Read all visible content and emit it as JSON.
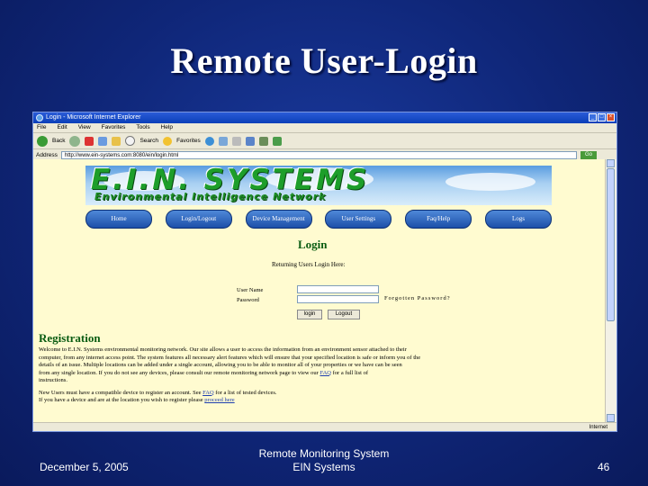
{
  "slide": {
    "title": "Remote User-Login",
    "footer_date": "December 5, 2005",
    "footer_center_line1": "Remote Monitoring System",
    "footer_center_line2": "EIN Systems",
    "slide_number": "46"
  },
  "browser": {
    "window_title": "Login - Microsoft Internet Explorer",
    "menu": [
      "File",
      "Edit",
      "View",
      "Favorites",
      "Tools",
      "Help"
    ],
    "toolbar": {
      "back": "Back",
      "search": "Search",
      "favorites": "Favorites"
    },
    "address_label": "Address",
    "address_value": "http://www.ein-systems.com:8080/ein/login.html",
    "go_label": "Go",
    "status_zone": "Internet"
  },
  "site": {
    "banner_title": "E.I.N. SYSTEMS",
    "banner_subtitle": "Environmental Intelligence Network",
    "nav": [
      {
        "label": "Home"
      },
      {
        "label": "Login/Logout"
      },
      {
        "label": "Device Management"
      },
      {
        "label": "User Settings"
      },
      {
        "label": "Faq/Help"
      },
      {
        "label": "Logs"
      }
    ],
    "login": {
      "heading": "Login",
      "subheading": "Returning Users Login Here:",
      "username_label": "User Name",
      "password_label": "Password",
      "forgot_label": "Forgotten Password?",
      "login_button": "login",
      "logout_button": "Logout"
    },
    "registration": {
      "heading": "Registration",
      "paragraph_lines": [
        "Welcome to E.I.N. Systems environmental monitoring network. Our site allows a user to access the information from an environment sensor attached to their",
        "computer, from any internet access point. The system features all necessary alert features which will ensure that your specified location is safe or inform you of the",
        "details of an issue. Multiple locations can be added under a single account, allowing you to be able to monitor all of your properties or we have can be seen",
        "from any single location. If you do not see any devices, please consult our remote monitoring network page to view our",
        "instructions."
      ],
      "faq_inline_link": "FAQ",
      "faq_inline_suffix": "for a full list of",
      "note_line1_prefix": "New Users must have a compatible device to register an account. See",
      "note_faq_link": "FAQ",
      "note_line1_suffix": "for a list of tested devices.",
      "note_line2_prefix": "If you have a device and are at the location you wish to register please",
      "proceed_link": "proceed here"
    }
  }
}
